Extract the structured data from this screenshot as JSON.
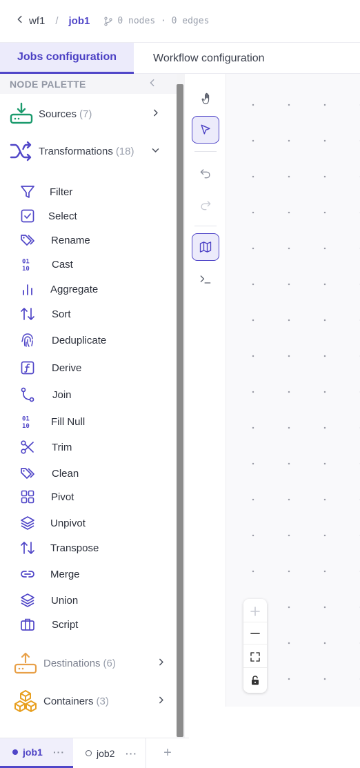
{
  "header": {
    "back_icon": "chevron-left-icon",
    "workflow_name": "wf1",
    "separator": "/",
    "job_name": "job1",
    "meta": "0 nodes · 0 edges"
  },
  "tabs": [
    {
      "label": "Jobs configuration",
      "active": true
    },
    {
      "label": "Workflow configuration",
      "active": false
    }
  ],
  "palette": {
    "title": "NODE PALETTE",
    "groups": {
      "sources": {
        "label": "Sources",
        "count": "(7)",
        "icon": "inbox-download-icon",
        "color": "#1a9a6c"
      },
      "transformations": {
        "label": "Transformations",
        "count": "(18)",
        "icon": "shuffle-icon",
        "color": "#5046c8"
      },
      "destinations": {
        "label": "Destinations",
        "count": "(6)",
        "icon": "inbox-upload-icon",
        "color": "#e8a048"
      },
      "containers": {
        "label": "Containers",
        "count": "(3)",
        "icon": "boxes-icon",
        "color": "#e8a020"
      }
    },
    "items": [
      {
        "label": "Filter",
        "icon": "funnel-icon"
      },
      {
        "label": "Select",
        "icon": "checkbox-icon"
      },
      {
        "label": "Rename",
        "icon": "tags-icon"
      },
      {
        "label": "Cast",
        "icon": "binary-icon"
      },
      {
        "label": "Aggregate",
        "icon": "bar-chart-icon"
      },
      {
        "label": "Sort",
        "icon": "arrows-up-down-icon"
      },
      {
        "label": "Deduplicate",
        "icon": "fingerprint-icon"
      },
      {
        "label": "Derive",
        "icon": "function-icon"
      },
      {
        "label": "Join",
        "icon": "git-merge-icon"
      },
      {
        "label": "Fill Null",
        "icon": "binary-icon"
      },
      {
        "label": "Trim",
        "icon": "scissors-icon"
      },
      {
        "label": "Clean",
        "icon": "tags-icon"
      },
      {
        "label": "Pivot",
        "icon": "grid-icon"
      },
      {
        "label": "Unpivot",
        "icon": "layers-icon"
      },
      {
        "label": "Transpose",
        "icon": "arrows-up-down-icon"
      },
      {
        "label": "Merge",
        "icon": "link-icon"
      },
      {
        "label": "Union",
        "icon": "layers-icon"
      },
      {
        "label": "Script",
        "icon": "briefcase-icon"
      }
    ]
  },
  "toolbar": [
    "hand-icon",
    "pointer-icon",
    "undo-icon",
    "redo-icon",
    "map-icon",
    "terminal-icon"
  ],
  "zoom_controls": [
    "zoom-in-icon",
    "zoom-out-icon",
    "fit-view-icon",
    "lock-icon"
  ],
  "job_tabs": [
    {
      "label": "job1",
      "more": "···",
      "active": true
    },
    {
      "label": "job2",
      "more": "···",
      "active": false
    }
  ],
  "add_tab": "+",
  "colors": {
    "accent": "#5046c8",
    "accent_bg": "#ecebfb",
    "source_green": "#1a9a6c",
    "dest_orange": "#e8a048"
  }
}
